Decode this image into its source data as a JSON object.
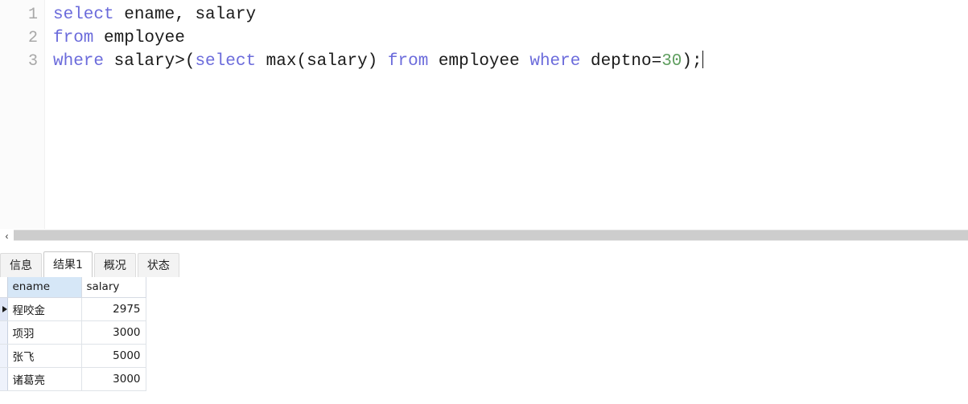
{
  "editor": {
    "line_numbers": [
      "1",
      "2",
      "3"
    ],
    "lines": [
      {
        "n": "1",
        "tokens": [
          {
            "t": "select",
            "k": "kw"
          },
          {
            "t": " ename, salary",
            "k": ""
          }
        ]
      },
      {
        "n": "2",
        "tokens": [
          {
            "t": "from",
            "k": "kw"
          },
          {
            "t": " employee",
            "k": ""
          }
        ]
      },
      {
        "n": "3",
        "tokens": [
          {
            "t": "where",
            "k": "kw"
          },
          {
            "t": " salary>(",
            "k": ""
          },
          {
            "t": "select",
            "k": "kw"
          },
          {
            "t": " max(salary) ",
            "k": ""
          },
          {
            "t": "from",
            "k": "kw"
          },
          {
            "t": " employee ",
            "k": ""
          },
          {
            "t": "where",
            "k": "kw"
          },
          {
            "t": " deptno=",
            "k": ""
          },
          {
            "t": "30",
            "k": "num"
          },
          {
            "t": ");",
            "k": ""
          }
        ]
      }
    ],
    "full_text": "select ename, salary\nfrom employee\nwhere salary>(select max(salary) from employee where deptno=30);",
    "colors": {
      "keyword": "#6b6bdb",
      "number": "#5f9e5f",
      "text": "#1a1a1a",
      "line_number": "#a8a8a8"
    }
  },
  "splitter": {
    "collapse_icon": "chevron-left-icon",
    "collapse_glyph": "‹",
    "scrollbar_color": "#cdcdcd"
  },
  "tabs": [
    {
      "label": "信息",
      "active": false
    },
    {
      "label": "结果1",
      "active": true
    },
    {
      "label": "概况",
      "active": false
    },
    {
      "label": "状态",
      "active": false
    }
  ],
  "result_grid": {
    "columns": [
      {
        "label": "ename",
        "align": "left",
        "selected": true
      },
      {
        "label": "salary",
        "align": "right",
        "selected": false
      }
    ],
    "rows": [
      {
        "marker": true,
        "ename": "程咬金",
        "salary": "2975"
      },
      {
        "marker": false,
        "ename": "项羽",
        "salary": "3000"
      },
      {
        "marker": false,
        "ename": "张飞",
        "salary": "5000"
      },
      {
        "marker": false,
        "ename": "诸葛亮",
        "salary": "3000"
      }
    ],
    "marker_icon": "play-triangle-icon",
    "header_selected_color": "#d6e7f7"
  }
}
